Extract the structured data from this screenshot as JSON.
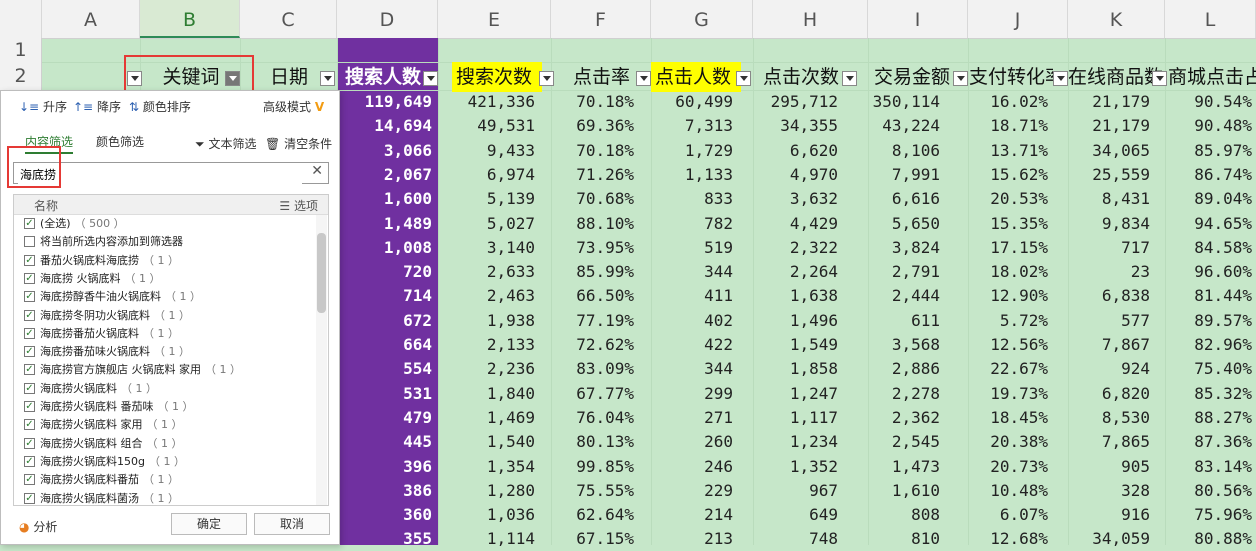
{
  "columns": [
    "A",
    "B",
    "C",
    "D",
    "E",
    "F",
    "G",
    "H",
    "I",
    "J",
    "K",
    "L"
  ],
  "rows": [
    "1",
    "2"
  ],
  "headers": [
    "关键词",
    "日期",
    "搜索人数",
    "搜索次数",
    "点击率",
    "点击人数",
    "点击次数",
    "交易金额",
    "支付转化率",
    "在线商品数",
    "商城点击占"
  ],
  "data_rows": [
    [
      "119,649",
      "421,336",
      "70.18%",
      "60,499",
      "295,712",
      "350,114",
      "16.02%",
      "21,179",
      "90.54%"
    ],
    [
      "14,694",
      "49,531",
      "69.36%",
      "7,313",
      "34,355",
      "43,224",
      "18.71%",
      "21,179",
      "90.48%"
    ],
    [
      "3,066",
      "9,433",
      "70.18%",
      "1,729",
      "6,620",
      "8,106",
      "13.71%",
      "34,065",
      "85.97%"
    ],
    [
      "2,067",
      "6,974",
      "71.26%",
      "1,133",
      "4,970",
      "7,991",
      "15.62%",
      "25,559",
      "86.74%"
    ],
    [
      "1,600",
      "5,139",
      "70.68%",
      "833",
      "3,632",
      "6,616",
      "20.53%",
      "8,431",
      "89.04%"
    ],
    [
      "1,489",
      "5,027",
      "88.10%",
      "782",
      "4,429",
      "5,650",
      "15.35%",
      "9,834",
      "94.65%"
    ],
    [
      "1,008",
      "3,140",
      "73.95%",
      "519",
      "2,322",
      "3,824",
      "17.15%",
      "717",
      "84.58%"
    ],
    [
      "720",
      "2,633",
      "85.99%",
      "344",
      "2,264",
      "2,791",
      "18.02%",
      "23",
      "96.60%"
    ],
    [
      "714",
      "2,463",
      "66.50%",
      "411",
      "1,638",
      "2,444",
      "12.90%",
      "6,838",
      "81.44%"
    ],
    [
      "672",
      "1,938",
      "77.19%",
      "402",
      "1,496",
      "611",
      "5.72%",
      "577",
      "89.57%"
    ],
    [
      "664",
      "2,133",
      "72.62%",
      "422",
      "1,549",
      "3,568",
      "12.56%",
      "7,867",
      "82.96%"
    ],
    [
      "554",
      "2,236",
      "83.09%",
      "344",
      "1,858",
      "2,886",
      "22.67%",
      "924",
      "75.40%"
    ],
    [
      "531",
      "1,840",
      "67.77%",
      "299",
      "1,247",
      "2,278",
      "19.73%",
      "6,820",
      "85.32%"
    ],
    [
      "479",
      "1,469",
      "76.04%",
      "271",
      "1,117",
      "2,362",
      "18.45%",
      "8,530",
      "88.27%"
    ],
    [
      "445",
      "1,540",
      "80.13%",
      "260",
      "1,234",
      "2,545",
      "20.38%",
      "7,865",
      "87.36%"
    ],
    [
      "396",
      "1,354",
      "99.85%",
      "246",
      "1,352",
      "1,473",
      "20.73%",
      "905",
      "83.14%"
    ],
    [
      "386",
      "1,280",
      "75.55%",
      "229",
      "967",
      "1,610",
      "10.48%",
      "328",
      "80.56%"
    ],
    [
      "360",
      "1,036",
      "62.64%",
      "214",
      "649",
      "808",
      "6.07%",
      "916",
      "75.96%"
    ],
    [
      "355",
      "1,114",
      "67.15%",
      "213",
      "748",
      "810",
      "12.68%",
      "34,059",
      "80.88%"
    ]
  ],
  "filter_panel": {
    "toolbar": {
      "asc": "升序",
      "desc": "降序",
      "color_sort": "颜色排序",
      "advanced": "高级模式"
    },
    "tabs": {
      "content": "内容筛选",
      "color": "颜色筛选"
    },
    "text_filter": "文本筛选",
    "clear": "清空条件",
    "search_value": "海底捞",
    "list_header": {
      "name": "名称",
      "options": "选项"
    },
    "items": [
      {
        "label": "(全选)",
        "count": "（ 500 ）",
        "checked": true
      },
      {
        "label": "将当前所选内容添加到筛选器",
        "count": "",
        "checked": false
      },
      {
        "label": "番茄火锅底料海底捞",
        "count": "（ 1 ）",
        "checked": true
      },
      {
        "label": "海底捞 火锅底料",
        "count": "（ 1 ）",
        "checked": true
      },
      {
        "label": "海底捞醇香牛油火锅底料",
        "count": "（ 1 ）",
        "checked": true
      },
      {
        "label": "海底捞冬阴功火锅底料",
        "count": "（ 1 ）",
        "checked": true
      },
      {
        "label": "海底捞番茄火锅底料",
        "count": "（ 1 ）",
        "checked": true
      },
      {
        "label": "海底捞番茄味火锅底料",
        "count": "（ 1 ）",
        "checked": true
      },
      {
        "label": "海底捞官方旗舰店 火锅底料 家用",
        "count": "（ 1 ）",
        "checked": true
      },
      {
        "label": "海底捞火锅底料",
        "count": "（ 1 ）",
        "checked": true
      },
      {
        "label": "海底捞火锅底料 番茄味",
        "count": "（ 1 ）",
        "checked": true
      },
      {
        "label": "海底捞火锅底料 家用",
        "count": "（ 1 ）",
        "checked": true
      },
      {
        "label": "海底捞火锅底料 组合",
        "count": "（ 1 ）",
        "checked": true
      },
      {
        "label": "海底捞火锅底料150g",
        "count": "（ 1 ）",
        "checked": true
      },
      {
        "label": "海底捞火锅底料番茄",
        "count": "（ 1 ）",
        "checked": true
      },
      {
        "label": "海底捞火锅底料菌汤",
        "count": "（ 1 ）",
        "checked": true
      }
    ],
    "analyze": "分析",
    "ok": "确定",
    "cancel": "取消"
  }
}
